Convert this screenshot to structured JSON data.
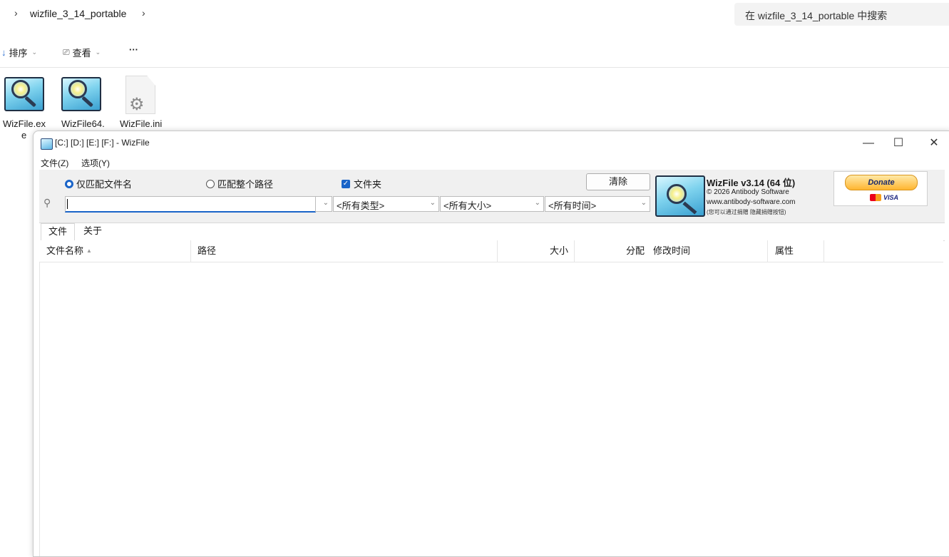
{
  "explorer": {
    "breadcrumb": "wizfile_3_14_portable",
    "search_placeholder": "在 wizfile_3_14_portable 中搜索",
    "toolbar": {
      "sort_label": "排序",
      "view_label": "查看",
      "more_label": "···"
    },
    "files": [
      {
        "label_line1": "WizFile.ex",
        "label_line2": "e"
      },
      {
        "label_line1": "WizFile64.",
        "label_line2": ""
      },
      {
        "label_line1": "WizFile.ini",
        "label_line2": ""
      }
    ]
  },
  "window": {
    "title": "[C:] [D:] [E:] [F:]  - WizFile",
    "controls": {
      "minimize": "—",
      "maximize": "☐",
      "close": "✕"
    },
    "menu": [
      "文件(Z)",
      "选项(Y)"
    ],
    "options": {
      "radio1": "仅匹配文件名",
      "radio2": "匹配整个路径",
      "checkbox": "文件夹",
      "clear_button": "清除"
    },
    "search": {
      "value": "",
      "type_filter": "<所有类型>",
      "size_filter": "<所有大小>",
      "time_filter": "<所有时间>"
    },
    "ad": {
      "title": "WizFile v3.14 (64 位)",
      "copyright": "© 2026 Antibody Software",
      "website": "www.antibody-software.com",
      "note": "(您可以通过捐赠 隐藏捐赠按钮)",
      "donate": "Donate",
      "visa": "VISA"
    },
    "tabs": [
      "文件",
      "关于"
    ],
    "columns": [
      "文件名称",
      "路径",
      "大小",
      "分配",
      "修改时间",
      "属性"
    ]
  }
}
